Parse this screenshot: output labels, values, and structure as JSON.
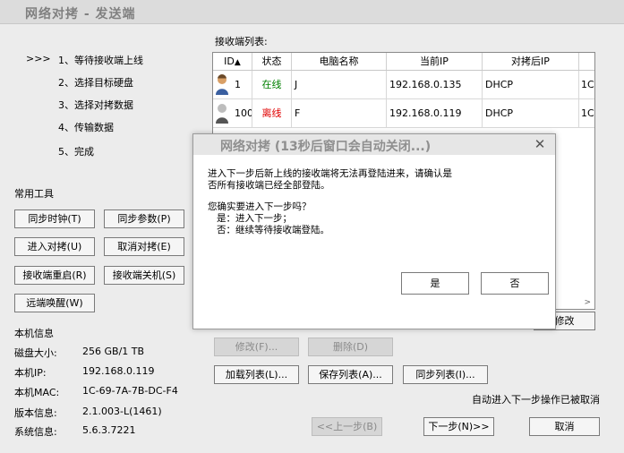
{
  "window": {
    "title": "网络对拷 - 发送端"
  },
  "steps": {
    "marker": ">>>",
    "items": [
      "1、等待接收端上线",
      "2、选择目标硬盘",
      "3、选择对拷数据",
      "4、传输数据",
      "5、完成"
    ]
  },
  "tools": {
    "heading": "常用工具",
    "sync_clock": "同步时钟(T)",
    "sync_params": "同步参数(P)",
    "enter_copy": "进入对拷(U)",
    "cancel_copy": "取消对拷(E)",
    "restart_receiver": "接收端重启(R)",
    "shutdown_receiver": "接收端关机(S)",
    "remote_wake": "远端唤醒(W)"
  },
  "info": {
    "heading": "本机信息",
    "disk_label": "磁盘大小:",
    "disk_value": "256 GB/1 TB",
    "ip_label": "本机IP:",
    "ip_value": "192.168.0.119",
    "mac_label": "本机MAC:",
    "mac_value": "1C-69-7A-7B-DC-F4",
    "version_label": "版本信息:",
    "version_value": "2.1.003-L(1461)",
    "system_label": "系统信息:",
    "system_value": "5.6.3.7221"
  },
  "list": {
    "label": "接收端列表:",
    "columns": [
      "ID",
      "状态",
      "电脑名称",
      "当前IP",
      "对拷后IP"
    ],
    "sort_icon": "arrow-up-icon",
    "rows": [
      {
        "id": "1",
        "status": "在线",
        "status_color": "#008000",
        "name": "J",
        "ip": "192.168.0.135",
        "after_ip": "DHCP",
        "extra": "1C-"
      },
      {
        "id": "100",
        "status": "离线",
        "status_color": "#e00000",
        "name": "F",
        "ip": "192.168.0.119",
        "after_ip": "DHCP",
        "extra": "1C-"
      }
    ],
    "scroll_right_icon": ">"
  },
  "actions": {
    "modify_right": "修改",
    "modify": "修改(F)...",
    "delete": "删除(D)",
    "load_list": "加载列表(L)...",
    "save_list": "保存列表(A)...",
    "sync_list": "同步列表(I)...",
    "auto_notice": "自动进入下一步操作已被取消"
  },
  "footer": {
    "prev": "<<上一步(B)",
    "next": "下一步(N)>>",
    "cancel": "取消"
  },
  "dialog": {
    "title": "网络对拷 (13秒后窗口会自动关闭...)",
    "close_icon": "✕",
    "line1": "进入下一步后新上线的接收端将无法再登陆进来，请确认是",
    "line2": "否所有接收端已经全部登陆。",
    "line3": "您确实要进入下一步吗？",
    "line4": "是：进入下一步；",
    "line5": "否：继续等待接收端登陆。",
    "yes": "是",
    "no": "否"
  }
}
